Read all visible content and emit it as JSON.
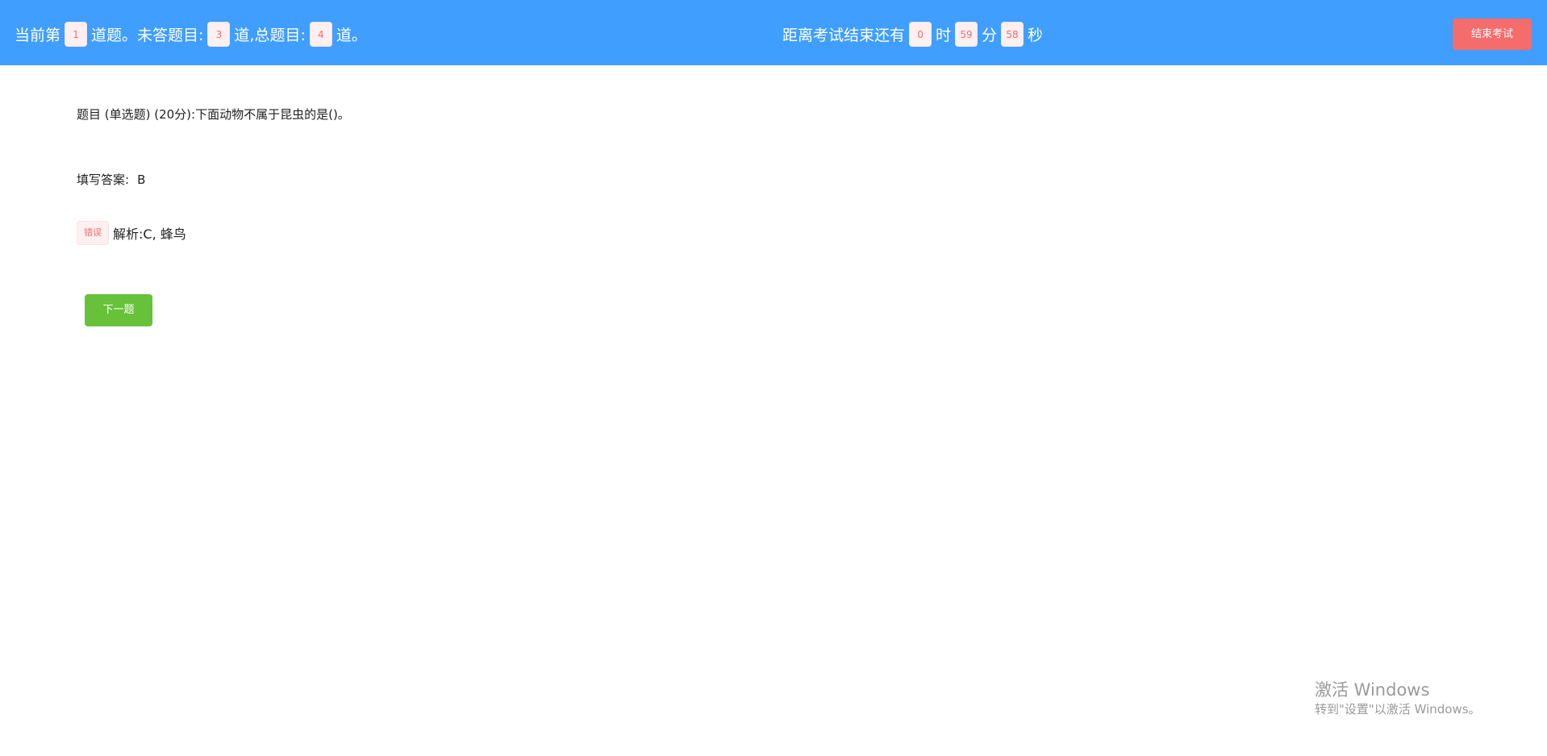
{
  "header": {
    "progress": {
      "prefix": "当前第",
      "current": "1",
      "mid1": "道题。未答题目:",
      "unanswered": "3",
      "mid2": "道,总题目:",
      "total": "4",
      "suffix": "道。"
    },
    "timer": {
      "prefix": "距离考试结束还有",
      "hours": "0",
      "hours_label": "时",
      "minutes": "59",
      "minutes_label": "分",
      "seconds": "58",
      "seconds_label": "秒"
    },
    "end_exam_label": "结束考试"
  },
  "question": {
    "text": "题目 (单选题) (20分):下面动物不属于昆虫的是()。"
  },
  "answer": {
    "label": "填写答案:",
    "value": "B"
  },
  "result": {
    "tag": "错误",
    "explanation": "解析:C, 蜂鸟"
  },
  "next_button_label": "下一题",
  "watermark": {
    "title": "激活 Windows",
    "subtitle": "转到\"设置\"以激活 Windows。"
  },
  "colors": {
    "header_bg": "#409eff",
    "danger": "#f56c6c",
    "success": "#67c23a"
  }
}
